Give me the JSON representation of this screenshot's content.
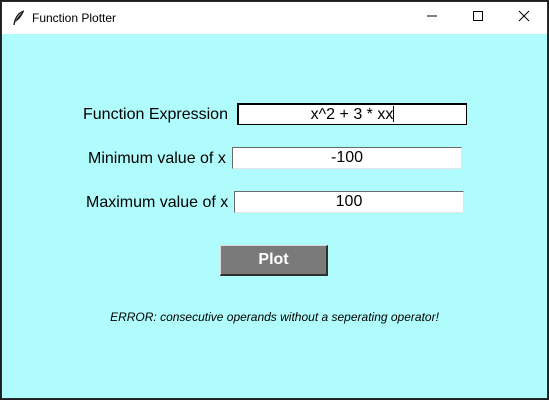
{
  "window": {
    "title": "Function Plotter"
  },
  "form": {
    "expression_label": "Function Expression",
    "expression_value": "x^2 + 3 * xx",
    "min_label": "Minimum value of x",
    "min_value": "-100",
    "max_label": "Maximum value of x",
    "max_value": "100"
  },
  "actions": {
    "plot_label": "Plot"
  },
  "status": {
    "error_message": "ERROR: consecutive operands without a seperating operator!"
  },
  "colors": {
    "background": "#b0fcfc",
    "button": "#7a7a7a",
    "button_text": "#ffffff"
  },
  "icons": {
    "app": "feather-icon",
    "minimize": "minimize-icon",
    "maximize": "maximize-icon",
    "close": "close-icon"
  }
}
